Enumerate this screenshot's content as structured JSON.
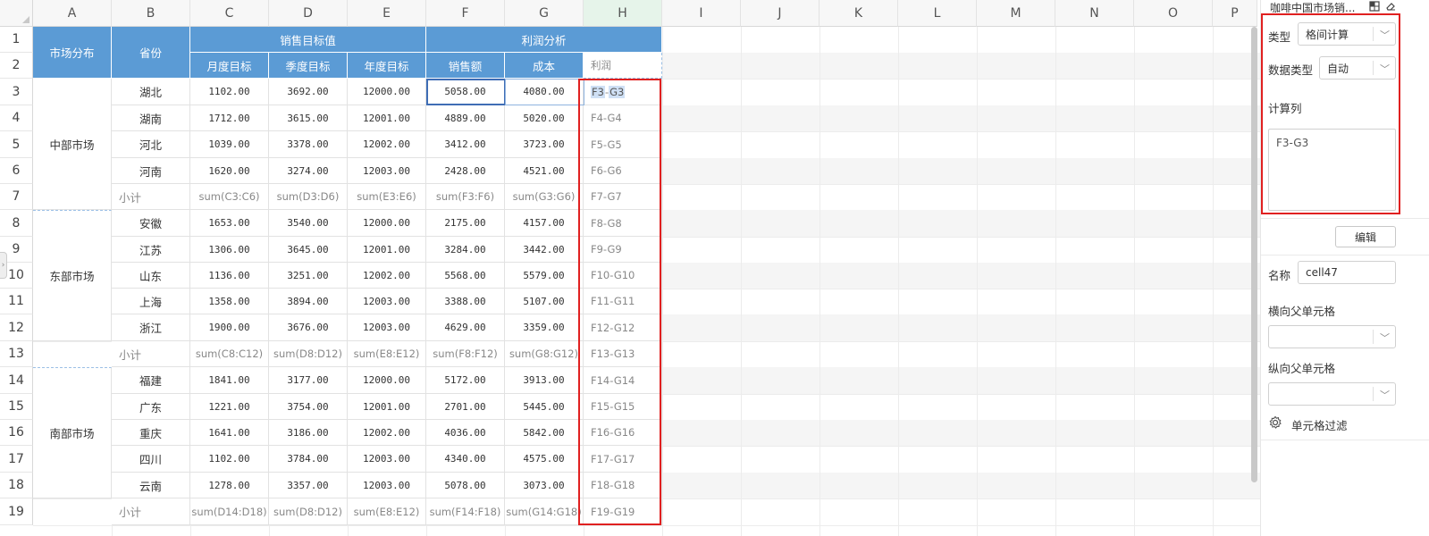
{
  "spreadsheet": {
    "columns": [
      "A",
      "B",
      "C",
      "D",
      "E",
      "F",
      "G",
      "H",
      "I",
      "J",
      "K",
      "L",
      "M",
      "N",
      "O",
      "P"
    ],
    "rows": [
      "1",
      "2",
      "3",
      "4",
      "5",
      "6",
      "7",
      "8",
      "9",
      "10",
      "11",
      "12",
      "13",
      "14",
      "15",
      "16",
      "17",
      "18",
      "19"
    ],
    "headers": {
      "market": "市场分布",
      "province": "省份",
      "sales_target_group": "销售目标值",
      "profit_group": "利润分析",
      "monthly": "月度目标",
      "quarterly": "季度目标",
      "yearly": "年度目标",
      "sales": "销售额",
      "cost": "成本",
      "profit": "利润"
    },
    "markets": [
      "中部市场",
      "东部市场",
      "南部市场"
    ],
    "data_rows": [
      {
        "province": "湖北",
        "c": "1102.00",
        "d": "3692.00",
        "e": "12000.00",
        "f": "5058.00",
        "g": "4080.00",
        "h_pre": "F3",
        "h_sep": "-",
        "h_post": "G3"
      },
      {
        "province": "湖南",
        "c": "1712.00",
        "d": "3615.00",
        "e": "12001.00",
        "f": "4889.00",
        "g": "5020.00",
        "h": "F4-G4"
      },
      {
        "province": "河北",
        "c": "1039.00",
        "d": "3378.00",
        "e": "12002.00",
        "f": "3412.00",
        "g": "3723.00",
        "h": "F5-G5"
      },
      {
        "province": "河南",
        "c": "1620.00",
        "d": "3274.00",
        "e": "12003.00",
        "f": "2428.00",
        "g": "4521.00",
        "h": "F6-G6"
      },
      {
        "province": "小计",
        "c": "sum(C3:C6)",
        "d": "sum(D3:D6)",
        "e": "sum(E3:E6)",
        "f": "sum(F3:F6)",
        "g": "sum(G3:G6)",
        "h": "F7-G7",
        "subtotal": true
      },
      {
        "province": "安徽",
        "c": "1653.00",
        "d": "3540.00",
        "e": "12000.00",
        "f": "2175.00",
        "g": "4157.00",
        "h": "F8-G8"
      },
      {
        "province": "江苏",
        "c": "1306.00",
        "d": "3645.00",
        "e": "12001.00",
        "f": "3284.00",
        "g": "3442.00",
        "h": "F9-G9"
      },
      {
        "province": "山东",
        "c": "1136.00",
        "d": "3251.00",
        "e": "12002.00",
        "f": "5568.00",
        "g": "5579.00",
        "h": "F10-G10"
      },
      {
        "province": "上海",
        "c": "1358.00",
        "d": "3894.00",
        "e": "12003.00",
        "f": "3388.00",
        "g": "5107.00",
        "h": "F11-G11"
      },
      {
        "province": "浙江",
        "c": "1900.00",
        "d": "3676.00",
        "e": "12003.00",
        "f": "4629.00",
        "g": "3359.00",
        "h": "F12-G12"
      },
      {
        "province": "小计",
        "c": "sum(C8:C12)",
        "d": "sum(D8:D12)",
        "e": "sum(E8:E12)",
        "f": "sum(F8:F12)",
        "g": "sum(G8:G12)",
        "h": "F13-G13",
        "subtotal": true
      },
      {
        "province": "福建",
        "c": "1841.00",
        "d": "3177.00",
        "e": "12000.00",
        "f": "5172.00",
        "g": "3913.00",
        "h": "F14-G14"
      },
      {
        "province": "广东",
        "c": "1221.00",
        "d": "3754.00",
        "e": "12001.00",
        "f": "2701.00",
        "g": "5445.00",
        "h": "F15-G15"
      },
      {
        "province": "重庆",
        "c": "1641.00",
        "d": "3186.00",
        "e": "12002.00",
        "f": "4036.00",
        "g": "5842.00",
        "h": "F16-G16"
      },
      {
        "province": "四川",
        "c": "1102.00",
        "d": "3784.00",
        "e": "12003.00",
        "f": "4340.00",
        "g": "4575.00",
        "h": "F17-G17"
      },
      {
        "province": "云南",
        "c": "1278.00",
        "d": "3357.00",
        "e": "12003.00",
        "f": "5078.00",
        "g": "3073.00",
        "h": "F18-G18"
      },
      {
        "province": "小计",
        "c": "sum(D14:D18)",
        "d": "sum(D8:D12)",
        "e": "sum(E8:E12)",
        "f": "sum(F14:F18)",
        "g": "sum(G14:G18)",
        "h": "F19-G19",
        "subtotal": true
      }
    ]
  },
  "panel": {
    "title": "咖啡中国市场销...",
    "type_label": "类型",
    "type_value": "格间计算",
    "data_type_label": "数据类型",
    "data_type_value": "自动",
    "calc_label": "计算列",
    "calc_value": "F3-G3",
    "edit_button": "编辑",
    "name_label": "名称",
    "name_value": "cell47",
    "h_parent_label": "横向父单元格",
    "v_parent_label": "纵向父单元格",
    "filter_label": "单元格过滤",
    "icons": [
      "grid-icon",
      "eraser-icon",
      "chevron-down-icon",
      "gear-icon"
    ]
  },
  "colors": {
    "header_blue": "#5b9bd5",
    "selection": "#3f6db5",
    "annotation_red": "#e02020"
  }
}
